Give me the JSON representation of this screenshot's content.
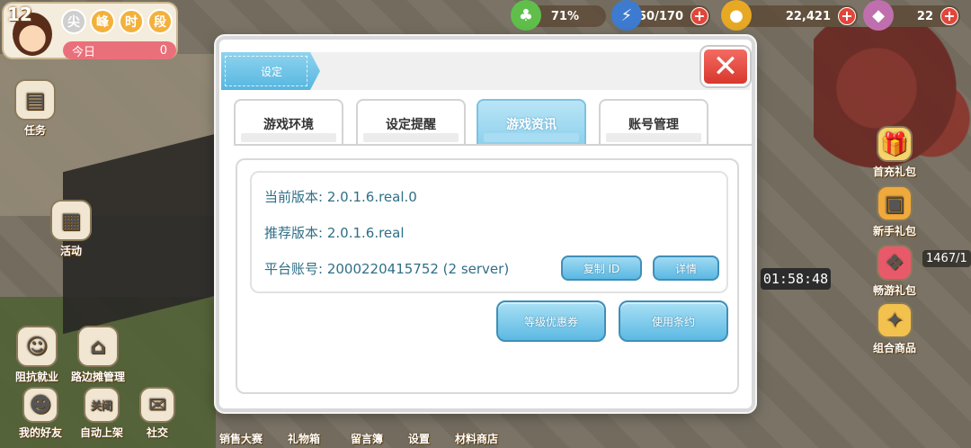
{
  "hud": {
    "level": "12",
    "badges": [
      {
        "label": "尖",
        "color": "#d9d9d9"
      },
      {
        "label": "峰",
        "color": "#f3b13b"
      },
      {
        "label": "时",
        "color": "#f3b13b"
      },
      {
        "label": "段",
        "color": "#f3b13b"
      }
    ],
    "today_label": "今日",
    "today_value": "0",
    "energy": "71%",
    "stamina": "50/170",
    "coins": "22,421",
    "gems": "22",
    "timer": "01:58:48",
    "counter_partial": "1467/1"
  },
  "left_menu": [
    {
      "label": "任务",
      "icon": "clipboard-icon"
    },
    {
      "label": "活动",
      "icon": "calendar-icon"
    },
    {
      "label": "阻抗就业",
      "icon": "girl-avatar-icon"
    },
    {
      "label": "路边摊管理",
      "icon": "stall-icon"
    },
    {
      "label": "我的好友",
      "icon": "friends-icon"
    },
    {
      "label": "关闭",
      "icon": "chef-hat-icon"
    },
    {
      "label": "自动上架",
      "icon": "chef-hat-icon"
    },
    {
      "label": "社交",
      "icon": "chat-icon"
    }
  ],
  "right_menu": [
    {
      "label": "首充礼包"
    },
    {
      "label": "新手礼包"
    },
    {
      "label": "畅游礼包"
    },
    {
      "label": "组合商品"
    }
  ],
  "bottom_menu": [
    {
      "label": "销售大赛"
    },
    {
      "label": "礼物箱"
    },
    {
      "label": "留言簿"
    },
    {
      "label": "设置"
    },
    {
      "label": "材料商店"
    }
  ],
  "dialog": {
    "title": "设定",
    "close_symbol": "✕",
    "tabs": [
      {
        "label": "游戏环境",
        "active": false
      },
      {
        "label": "设定提醒",
        "active": false
      },
      {
        "label": "游戏资讯",
        "active": true
      },
      {
        "label": "账号管理",
        "active": false
      }
    ],
    "info": {
      "current_version_label": "当前版本:",
      "current_version": "2.0.1.6.real.0",
      "recommended_version_label": "推荐版本:",
      "recommended_version": "2.0.1.6.real",
      "platform_account_label": "平台账号:",
      "platform_account": "2000220415752 (2 server)"
    },
    "copy_id_button": "复制 ID",
    "details_button": "详情",
    "level_coupon_button": "等级优惠券",
    "terms_button": "使用条约"
  },
  "colors": {
    "accent_blue": "#5cb9e3",
    "close_red": "#d8372c",
    "info_text": "#2f6f86"
  }
}
